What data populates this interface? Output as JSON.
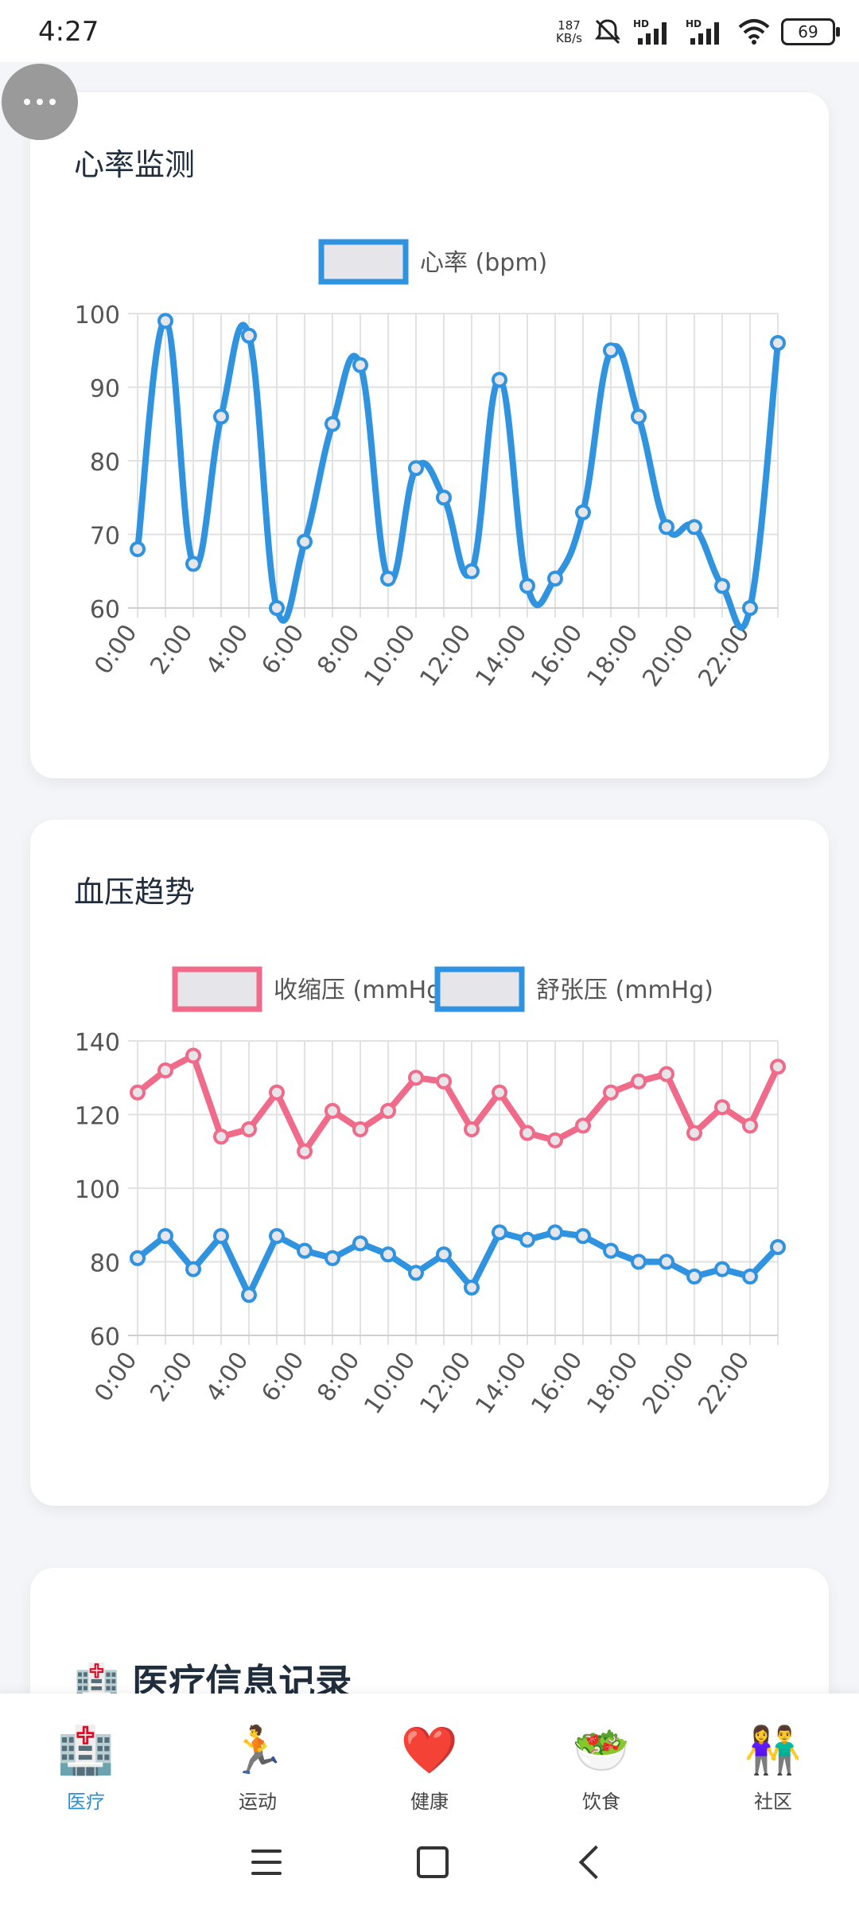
{
  "status_bar": {
    "time": "4:27",
    "net_speed_value": "187",
    "net_speed_unit": "KB/s",
    "battery": "69",
    "icons": [
      "bell-off-icon",
      "hd-signal-icon",
      "hd-signal-icon",
      "wifi-icon",
      "battery-icon"
    ]
  },
  "floating_button": {
    "icon": "more-dots-icon"
  },
  "heart_card": {
    "title": "心率监测"
  },
  "bp_card": {
    "title": "血压趋势"
  },
  "records_card": {
    "title": "医疗信息记录"
  },
  "chart_data": [
    {
      "type": "line",
      "title": "心率监测",
      "categories": [
        "0:00",
        "1:00",
        "2:00",
        "3:00",
        "4:00",
        "5:00",
        "6:00",
        "7:00",
        "8:00",
        "9:00",
        "10:00",
        "11:00",
        "12:00",
        "13:00",
        "14:00",
        "15:00",
        "16:00",
        "17:00",
        "18:00",
        "19:00",
        "20:00",
        "21:00",
        "22:00",
        "23:00"
      ],
      "tick_labels": [
        "0:00",
        "2:00",
        "4:00",
        "6:00",
        "8:00",
        "10:00",
        "12:00",
        "14:00",
        "16:00",
        "18:00",
        "20:00",
        "22:00"
      ],
      "series": [
        {
          "name": "心率 (bpm)",
          "color": "#2f93e0",
          "values": [
            68,
            99,
            66,
            86,
            97,
            60,
            69,
            85,
            93,
            64,
            79,
            75,
            65,
            91,
            63,
            64,
            73,
            95,
            86,
            71,
            71,
            63,
            60,
            96
          ]
        }
      ],
      "ylim": [
        60,
        100
      ],
      "yticks": [
        60,
        70,
        80,
        90,
        100
      ],
      "grid": true,
      "legend": "top",
      "smooth": true
    },
    {
      "type": "line",
      "title": "血压趋势",
      "categories": [
        "0:00",
        "1:00",
        "2:00",
        "3:00",
        "4:00",
        "5:00",
        "6:00",
        "7:00",
        "8:00",
        "9:00",
        "10:00",
        "11:00",
        "12:00",
        "13:00",
        "14:00",
        "15:00",
        "16:00",
        "17:00",
        "18:00",
        "19:00",
        "20:00",
        "21:00",
        "22:00",
        "23:00"
      ],
      "tick_labels": [
        "0:00",
        "2:00",
        "4:00",
        "6:00",
        "8:00",
        "10:00",
        "12:00",
        "14:00",
        "16:00",
        "18:00",
        "20:00",
        "22:00"
      ],
      "series": [
        {
          "name": "收缩压 (mmHg)",
          "color": "#f06a8a",
          "values": [
            126,
            132,
            136,
            114,
            116,
            126,
            110,
            121,
            116,
            121,
            130,
            129,
            116,
            126,
            115,
            113,
            117,
            126,
            129,
            131,
            115,
            122,
            117,
            133
          ]
        },
        {
          "name": "舒张压 (mmHg)",
          "color": "#2f93e0",
          "values": [
            81,
            87,
            78,
            87,
            71,
            87,
            83,
            81,
            85,
            82,
            77,
            82,
            73,
            88,
            86,
            88,
            87,
            83,
            80,
            80,
            76,
            78,
            76,
            84
          ]
        }
      ],
      "ylim": [
        60,
        140
      ],
      "yticks": [
        60,
        80,
        100,
        120,
        140
      ],
      "grid": true,
      "legend": "top",
      "smooth": false
    }
  ],
  "nav": {
    "items": [
      {
        "icon": "🏥",
        "icon_name": "hospital-icon",
        "label": "医疗",
        "active": true
      },
      {
        "icon": "🏃",
        "icon_name": "running-icon",
        "label": "运动",
        "active": false
      },
      {
        "icon": "❤️",
        "icon_name": "heart-icon",
        "label": "健康",
        "active": false
      },
      {
        "icon": "🥗",
        "icon_name": "salad-icon",
        "label": "饮食",
        "active": false
      },
      {
        "icon": "👫",
        "icon_name": "people-icon",
        "label": "社区",
        "active": false
      }
    ]
  },
  "colors": {
    "accent": "#2b8ed8",
    "systolic": "#f06a8a",
    "diastolic": "#2f93e0"
  }
}
